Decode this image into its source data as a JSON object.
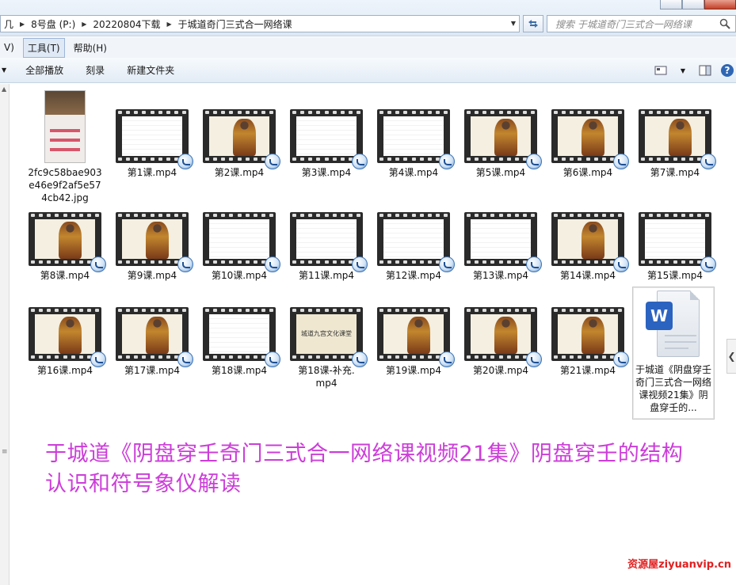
{
  "address": {
    "crumbs": [
      "几",
      "8号盘 (P:)",
      "20220804下载",
      "于城道奇门三式合一网络课"
    ],
    "search_placeholder": "搜索 于城道奇门三式合一网络课"
  },
  "menu": {
    "items": [
      "V)",
      "工具(T)",
      "帮助(H)"
    ]
  },
  "commands": {
    "play_all": "全部播放",
    "burn": "刻录",
    "new_folder": "新建文件夹"
  },
  "files": [
    {
      "name": "2fc9c58bae903e46e9f2af5e574cb42.jpg",
      "kind": "jpg"
    },
    {
      "name": "第1课.mp4",
      "kind": "doc"
    },
    {
      "name": "第2课.mp4",
      "kind": "figure"
    },
    {
      "name": "第3课.mp4",
      "kind": "doc"
    },
    {
      "name": "第4课.mp4",
      "kind": "doc"
    },
    {
      "name": "第5课.mp4",
      "kind": "figure"
    },
    {
      "name": "第6课.mp4",
      "kind": "figure"
    },
    {
      "name": "第7课.mp4",
      "kind": "figure"
    },
    {
      "name": "第8课.mp4",
      "kind": "figure"
    },
    {
      "name": "第9课.mp4",
      "kind": "figure"
    },
    {
      "name": "第10课.mp4",
      "kind": "doc"
    },
    {
      "name": "第11课.mp4",
      "kind": "doc"
    },
    {
      "name": "第12课.mp4",
      "kind": "doc"
    },
    {
      "name": "第13课.mp4",
      "kind": "doc"
    },
    {
      "name": "第14课.mp4",
      "kind": "figure"
    },
    {
      "name": "第15课.mp4",
      "kind": "doc"
    },
    {
      "name": "第16课.mp4",
      "kind": "figure"
    },
    {
      "name": "第17课.mp4",
      "kind": "figure"
    },
    {
      "name": "第18课.mp4",
      "kind": "doc"
    },
    {
      "name": "第18课-补充.mp4",
      "kind": "banner",
      "banner_text": "城道九宫文化课堂"
    },
    {
      "name": "第19课.mp4",
      "kind": "figure"
    },
    {
      "name": "第20课.mp4",
      "kind": "figure"
    },
    {
      "name": "第21课.mp4",
      "kind": "figure"
    },
    {
      "name": "于城道《阴盘穿壬奇门三式合一网络课视频21集》阴盘穿壬的...",
      "kind": "word",
      "badge": "W"
    }
  ],
  "overlay": {
    "line1": "于城道《阴盘穿壬奇门三式合一网络课视频21集》阴盘穿壬的结构",
    "line2": "认识和符号象仪解读"
  },
  "watermark": "资源屋ziyuanvip.cn"
}
